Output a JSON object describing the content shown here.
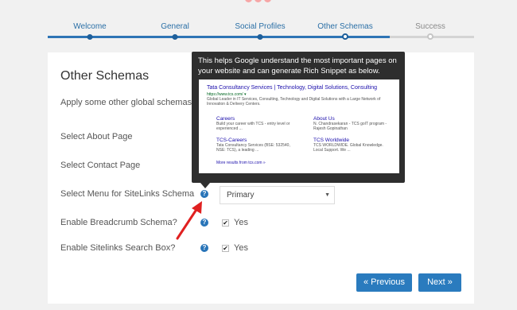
{
  "wizard": {
    "steps": [
      {
        "label": "Welcome",
        "state": "done"
      },
      {
        "label": "General",
        "state": "done"
      },
      {
        "label": "Social Profiles",
        "state": "done"
      },
      {
        "label": "Other Schemas",
        "state": "current"
      },
      {
        "label": "Success",
        "state": "pending"
      }
    ]
  },
  "card": {
    "title": "Other Schemas",
    "intro": "Apply some other global schemas f",
    "rows": [
      {
        "label": "Select About Page"
      },
      {
        "label": "Select Contact Page"
      },
      {
        "label": "Select Menu for SiteLinks Schema",
        "help": "?",
        "select_value": "Primary"
      },
      {
        "label": "Enable Breadcrumb Schema?",
        "help": "?",
        "checked": true,
        "checkbox_label": "Yes"
      },
      {
        "label": "Enable Sitelinks Search Box?",
        "help": "?",
        "checked": true,
        "checkbox_label": "Yes"
      }
    ],
    "previous_label": "« Previous",
    "next_label": "Next »"
  },
  "tooltip": {
    "text": "This helps Google understand the most important pages on your website and can generate Rich Snippet as below.",
    "snippet": {
      "title": "Tata Consultancy Services | Technology, Digital Solutions, Consulting",
      "url": "https://www.tcs.com/ ▾",
      "description": "Global Leader in IT Services, Consulting, Technology and Digital Solutions with a Large Network of Innovation & Delivery Centers.",
      "sitelinks": [
        {
          "title": "Careers",
          "desc": "Build your career with TCS - entry level or experienced ..."
        },
        {
          "title": "About Us",
          "desc": "N. Chandrasekaran - TCS goIT program - Rajesh Gopinathan"
        },
        {
          "title": "TCS-Careers",
          "desc": "Tata Consultancy Services (BSE: 532540, NSE: TCS), a leading ..."
        },
        {
          "title": "TCS Worldwide",
          "desc": "TCS WORLDWIDE. Global Knowledge. Local Support. We ..."
        }
      ],
      "more": "More results from tcs.com »"
    }
  },
  "colors": {
    "accent": "#2a7bbe",
    "arrow": "#e02020",
    "tooltip_bg": "#2e2e2e"
  },
  "icons": {
    "help": "help-icon",
    "check": "checkmark-icon",
    "caret": "chevron-down-icon"
  }
}
